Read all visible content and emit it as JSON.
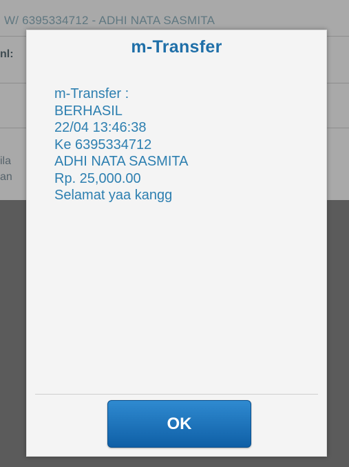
{
  "background": {
    "header_text": "W/ 6395334712 - ADHI NATA SASMITA",
    "left_fragments": [
      "nl:",
      "ila",
      "an"
    ]
  },
  "dialog": {
    "title": "m-Transfer",
    "lines": [
      "m-Transfer :",
      "BERHASIL",
      "22/04 13:46:38",
      "Ke 6395334712",
      "ADHI NATA SASMITA",
      "Rp. 25,000.00",
      "Selamat yaa kangg"
    ],
    "ok_label": "OK"
  },
  "colors": {
    "accent": "#1f6fa8",
    "button": "#1a6fb8"
  }
}
